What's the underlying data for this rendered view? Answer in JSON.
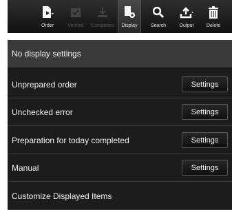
{
  "toolbar": {
    "items": [
      {
        "label": "Order",
        "icon": "order-icon"
      },
      {
        "label": "Verified",
        "icon": "verify-icon"
      },
      {
        "label": "Completed",
        "icon": "complete-icon"
      },
      {
        "label": "Display",
        "icon": "display-settings-icon"
      },
      {
        "label": "Search",
        "icon": "search-icon"
      },
      {
        "label": "Output",
        "icon": "output-icon"
      },
      {
        "label": "Delete",
        "icon": "delete-icon"
      }
    ]
  },
  "menu": {
    "items": [
      {
        "label": "No display settings"
      },
      {
        "label": "Unprepared order",
        "button": "Settings"
      },
      {
        "label": "Unchecked error",
        "button": "Settings"
      },
      {
        "label": "Preparation for today completed",
        "button": "Settings"
      },
      {
        "label": "Manual",
        "button": "Settings"
      },
      {
        "label": "Customize Displayed Items"
      }
    ]
  }
}
